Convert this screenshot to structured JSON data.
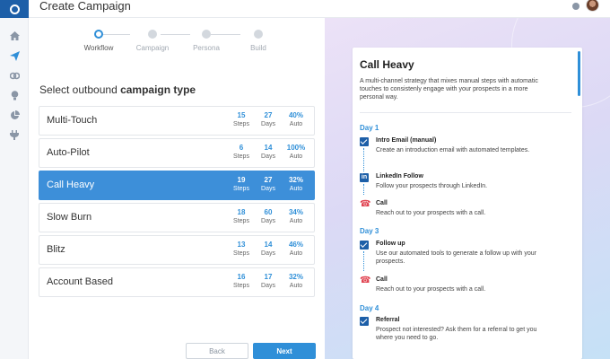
{
  "header": {
    "title": "Create Campaign"
  },
  "stepper": [
    {
      "label": "Workflow",
      "active": true
    },
    {
      "label": "Campaign",
      "active": false
    },
    {
      "label": "Persona",
      "active": false
    },
    {
      "label": "Build",
      "active": false
    }
  ],
  "section": {
    "prefix": "Select outbound ",
    "bold": "campaign type"
  },
  "types": [
    {
      "name": "Multi-Touch",
      "steps": "15",
      "days": "27",
      "auto": "40%",
      "selected": false
    },
    {
      "name": "Auto-Pilot",
      "steps": "6",
      "days": "14",
      "auto": "100%",
      "selected": false
    },
    {
      "name": "Call Heavy",
      "steps": "19",
      "days": "27",
      "auto": "32%",
      "selected": true
    },
    {
      "name": "Slow Burn",
      "steps": "18",
      "days": "60",
      "auto": "34%",
      "selected": false
    },
    {
      "name": "Blitz",
      "steps": "13",
      "days": "14",
      "auto": "46%",
      "selected": false
    },
    {
      "name": "Account Based",
      "steps": "16",
      "days": "17",
      "auto": "32%",
      "selected": false
    }
  ],
  "units": {
    "steps": "Steps",
    "days": "Days",
    "auto": "Auto"
  },
  "buttons": {
    "back": "Back",
    "next": "Next"
  },
  "detail": {
    "title": "Call Heavy",
    "description": "A multi-channel strategy that mixes manual steps with automatic touches to consistenly engage with your prospects in a more personal way.",
    "days": [
      {
        "label": "Day 1",
        "activities": [
          {
            "icon": "mail-icon",
            "name": "Intro Email (manual)",
            "desc": "Create an introduction email with automated templates."
          },
          {
            "icon": "linkedin-icon",
            "name": "LinkedIn Follow",
            "desc": "Follow your prospects through LinkedIn."
          },
          {
            "icon": "phone-icon",
            "name": "Call",
            "desc": "Reach out to your prospects with a call."
          }
        ]
      },
      {
        "label": "Day 3",
        "activities": [
          {
            "icon": "mail-icon",
            "name": "Follow up",
            "desc": "Use our automated tools to generate a follow up with your prospects."
          },
          {
            "icon": "phone-icon",
            "name": "Call",
            "desc": "Reach out to your prospects with a call."
          }
        ]
      },
      {
        "label": "Day 4",
        "activities": [
          {
            "icon": "mail-icon",
            "name": "Referral",
            "desc": "Prospect not interested? Ask them for a referral to get you where you need to go."
          }
        ]
      }
    ]
  },
  "colors": {
    "accent": "#2f8fd8",
    "selected_row": "#3d8fd9",
    "brand_dark": "#1d5fa8",
    "call_red": "#e0414f"
  },
  "sidebar_icons": [
    "logo-icon",
    "home-icon",
    "send-icon",
    "link-icon",
    "lightbulb-icon",
    "pie-chart-icon",
    "plug-icon"
  ]
}
